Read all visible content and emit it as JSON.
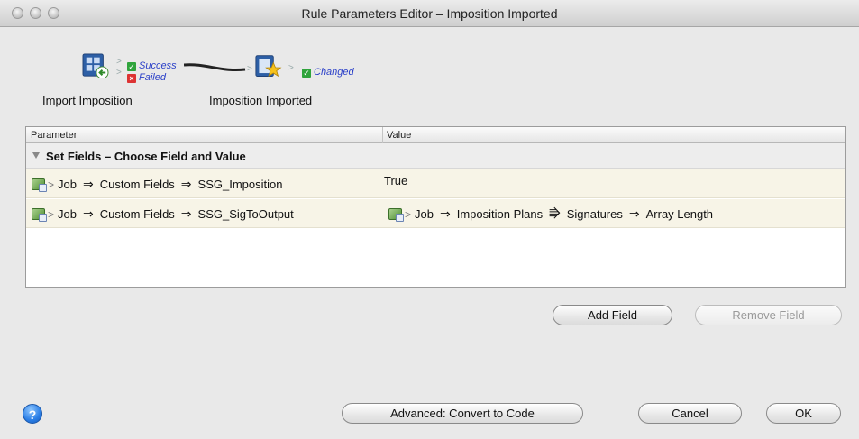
{
  "window": {
    "title": "Rule Parameters Editor – Imposition Imported"
  },
  "flow": {
    "node1": {
      "label": "Import Imposition",
      "icon": "import-imposition-icon",
      "outputs": [
        {
          "label": "Success",
          "status": "green"
        },
        {
          "label": "Failed",
          "status": "red"
        }
      ]
    },
    "node2": {
      "label": "Imposition Imported",
      "icon": "imposition-imported-icon",
      "outputs": [
        {
          "label": "Changed",
          "status": "green"
        }
      ]
    }
  },
  "table": {
    "headers": {
      "parameter": "Parameter",
      "value": "Value"
    },
    "group": {
      "title": "Set Fields – Choose Field and Value"
    },
    "rows": [
      {
        "parameter": [
          "Job",
          "Custom Fields",
          "SSG_Imposition"
        ],
        "value_text": "True"
      },
      {
        "parameter": [
          "Job",
          "Custom Fields",
          "SSG_SigToOutput"
        ],
        "value_path": [
          "Job",
          "Imposition Plans",
          "Signatures",
          "Array Length"
        ]
      }
    ]
  },
  "buttons": {
    "add_field": "Add Field",
    "remove_field": "Remove Field",
    "advanced": "Advanced: Convert to Code",
    "cancel": "Cancel",
    "ok": "OK",
    "help": "?"
  },
  "colors": {
    "row_bg": "#f7f4e7",
    "link_blue": "#2a3fc8",
    "success": "#2fa43c",
    "failed": "#d33"
  }
}
